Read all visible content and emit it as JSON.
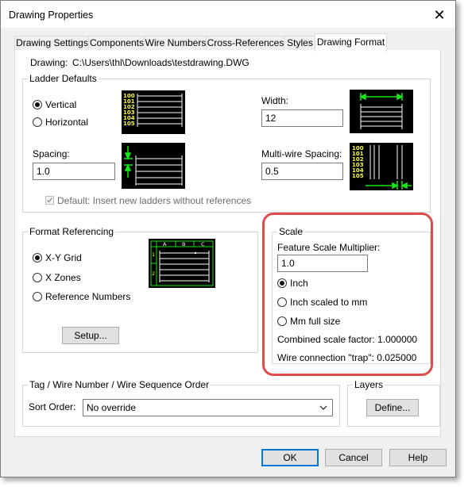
{
  "title": "Drawing Properties",
  "close_glyph": "✕",
  "tabs": [
    {
      "label": "Drawing Settings"
    },
    {
      "label": "Components"
    },
    {
      "label": "Wire Numbers"
    },
    {
      "label": "Cross-References"
    },
    {
      "label": "Styles"
    },
    {
      "label": "Drawing Format"
    }
  ],
  "drawing": {
    "label": "Drawing:",
    "path": "C:\\Users\\thl\\Downloads\\testdrawing.DWG"
  },
  "ladder": {
    "title": "Ladder Defaults",
    "vertical": "Vertical",
    "horizontal": "Horizontal",
    "width_label": "Width:",
    "width_value": "12",
    "spacing_label": "Spacing:",
    "spacing_value": "1.0",
    "multiwire_label": "Multi-wire Spacing:",
    "multiwire_value": "0.5",
    "default_checkbox": "Default: Insert new ladders without references",
    "numbers": [
      "100",
      "101",
      "102",
      "103",
      "104",
      "105"
    ]
  },
  "format": {
    "title": "Format Referencing",
    "xy": "X-Y Grid",
    "xzones": "X Zones",
    "refnums": "Reference Numbers",
    "setup": "Setup...",
    "grid_cols": [
      "A",
      "B",
      "C"
    ],
    "grid_rows": [
      "1",
      "2"
    ]
  },
  "scale": {
    "title": "Scale",
    "multiplier_label": "Feature Scale Multiplier:",
    "multiplier_value": "1.0",
    "inch": "Inch",
    "inch_mm": "Inch scaled to mm",
    "mm_full": "Mm full size",
    "combined": "Combined scale factor: 1.000000",
    "trap": "Wire connection \"trap\": 0.025000"
  },
  "tag": {
    "title": "Tag / Wire Number / Wire Sequence Order",
    "sort_label": "Sort Order:",
    "sort_value": "No override"
  },
  "layers": {
    "title": "Layers",
    "define": "Define..."
  },
  "buttons": {
    "ok": "OK",
    "cancel": "Cancel",
    "help": "Help"
  },
  "colors": {
    "accent": "#0078d7",
    "callout": "#e04b4b",
    "preview_yellow": "#ffff33",
    "preview_green": "#19e619"
  }
}
